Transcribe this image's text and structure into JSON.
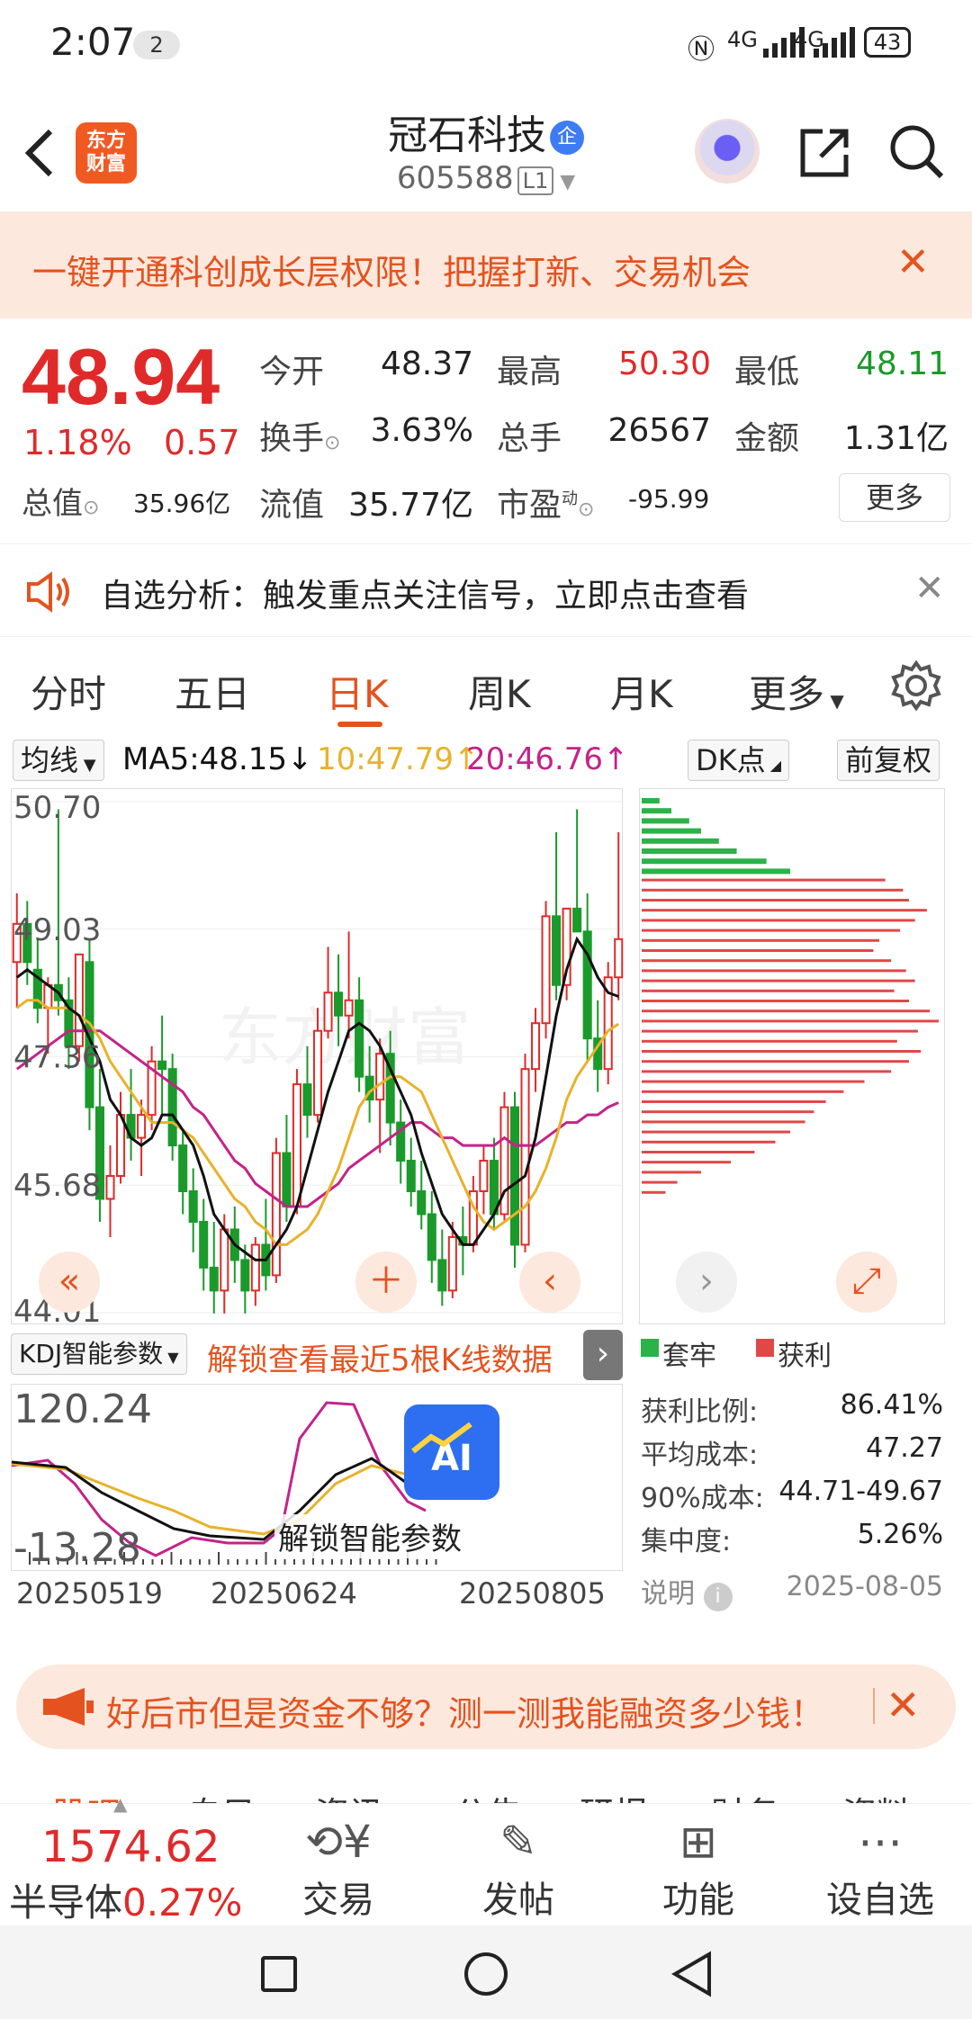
{
  "status": {
    "time": "2:07",
    "notif_count": "2",
    "signal1": "4G",
    "signal2": "4G",
    "battery": "43"
  },
  "header": {
    "logo_line1": "东方",
    "logo_line2": "财富",
    "title": "冠石科技",
    "badge": "企",
    "code": "605588",
    "level": "L1"
  },
  "promo": {
    "text": "一键开通科创成长层权限！把握打新、交易机会"
  },
  "quote": {
    "price": "48.94",
    "pct": "1.18%",
    "change": "0.57",
    "open_label": "今开",
    "open": "48.37",
    "high_label": "最高",
    "high": "50.30",
    "low_label": "最低",
    "low": "48.11",
    "turnover_label": "换手",
    "turnover": "3.63%",
    "volume_label": "总手",
    "volume": "26567",
    "amount_label": "金额",
    "amount": "1.31亿",
    "mktcap_label": "总值",
    "mktcap": "35.96亿",
    "float_label": "流值",
    "float": "35.77亿",
    "pe_label": "市盈",
    "pe_sup": "动",
    "pe": "-95.99",
    "more": "更多"
  },
  "notice": {
    "text": "自选分析：触发重点关注信号，立即点击查看"
  },
  "tabs": [
    "分时",
    "五日",
    "日K",
    "周K",
    "月K",
    "更多"
  ],
  "ma": {
    "selector": "均线",
    "ma5": "MA5:48.15↓",
    "ma10": "10:47.79↑",
    "ma20": "20:46.76↑",
    "dk": "DK点",
    "adjust": "前复权"
  },
  "chart_data": {
    "type": "candlestick",
    "y_ticks": [
      "50.70",
      "49.03",
      "47.36",
      "45.68",
      "44.01"
    ],
    "ylim": [
      44.01,
      50.7
    ],
    "x_ticks": [
      "20250519",
      "20250624",
      "20250805"
    ],
    "ohlc": [
      [
        48.6,
        49.5,
        48.0,
        49.1
      ],
      [
        49.1,
        49.4,
        48.3,
        48.6
      ],
      [
        48.5,
        48.9,
        47.8,
        48.0
      ],
      [
        48.0,
        48.4,
        47.4,
        48.3
      ],
      [
        48.3,
        50.6,
        47.9,
        48.1
      ],
      [
        48.1,
        48.4,
        47.2,
        47.5
      ],
      [
        47.5,
        48.7,
        47.3,
        48.7
      ],
      [
        48.6,
        48.9,
        46.4,
        46.7
      ],
      [
        46.7,
        47.2,
        45.2,
        45.5
      ],
      [
        45.5,
        46.2,
        45.0,
        45.8
      ],
      [
        45.8,
        46.9,
        45.7,
        46.6
      ],
      [
        46.6,
        47.2,
        46.0,
        46.3
      ],
      [
        46.3,
        46.8,
        45.8,
        46.6
      ],
      [
        46.6,
        47.5,
        46.4,
        47.3
      ],
      [
        47.3,
        47.9,
        46.6,
        47.2
      ],
      [
        47.2,
        47.4,
        46.0,
        46.2
      ],
      [
        46.2,
        46.4,
        45.3,
        45.6
      ],
      [
        45.6,
        45.9,
        44.8,
        45.2
      ],
      [
        45.2,
        45.5,
        44.3,
        44.6
      ],
      [
        44.6,
        45.2,
        44.0,
        44.3
      ],
      [
        44.3,
        45.3,
        44.0,
        45.1
      ],
      [
        45.1,
        45.4,
        44.4,
        44.7
      ],
      [
        44.7,
        44.9,
        44.0,
        44.3
      ],
      [
        44.3,
        45.0,
        44.1,
        44.9
      ],
      [
        44.9,
        45.5,
        44.3,
        44.5
      ],
      [
        44.5,
        46.3,
        44.4,
        46.1
      ],
      [
        46.1,
        46.6,
        45.2,
        45.4
      ],
      [
        45.4,
        47.2,
        45.3,
        47.0
      ],
      [
        47.0,
        47.5,
        46.3,
        46.6
      ],
      [
        46.6,
        48.0,
        46.5,
        47.7
      ],
      [
        47.7,
        48.8,
        47.6,
        48.2
      ],
      [
        48.2,
        48.7,
        47.5,
        47.9
      ],
      [
        47.9,
        49.0,
        47.6,
        48.1
      ],
      [
        48.1,
        48.4,
        46.9,
        47.1
      ],
      [
        47.1,
        47.5,
        46.5,
        46.8
      ],
      [
        46.8,
        47.6,
        46.1,
        47.4
      ],
      [
        47.4,
        47.7,
        46.2,
        46.5
      ],
      [
        46.5,
        46.8,
        45.7,
        46.0
      ],
      [
        46.0,
        46.3,
        45.4,
        45.6
      ],
      [
        45.6,
        46.0,
        45.1,
        45.3
      ],
      [
        45.3,
        45.6,
        44.4,
        44.7
      ],
      [
        44.7,
        45.1,
        44.1,
        44.3
      ],
      [
        44.3,
        45.2,
        44.2,
        45.0
      ],
      [
        45.0,
        45.4,
        44.5,
        44.9
      ],
      [
        44.9,
        45.8,
        44.8,
        45.6
      ],
      [
        45.6,
        46.2,
        45.3,
        46.0
      ],
      [
        46.0,
        46.3,
        45.1,
        45.3
      ],
      [
        45.3,
        46.9,
        45.2,
        46.7
      ],
      [
        46.7,
        46.9,
        44.6,
        44.9
      ],
      [
        44.9,
        47.4,
        44.8,
        47.2
      ],
      [
        47.2,
        48.0,
        46.9,
        47.8
      ],
      [
        47.8,
        49.4,
        47.6,
        49.2
      ],
      [
        49.2,
        50.3,
        48.1,
        48.3
      ],
      [
        48.3,
        49.3,
        48.1,
        49.3
      ],
      [
        49.3,
        50.6,
        49.0,
        49.0
      ],
      [
        49.0,
        49.5,
        47.3,
        47.6
      ],
      [
        47.6,
        48.1,
        46.9,
        47.2
      ],
      [
        47.2,
        48.6,
        47.0,
        48.4
      ],
      [
        48.4,
        50.3,
        48.1,
        48.9
      ]
    ],
    "ma5": [
      48.4,
      48.5,
      48.4,
      48.3,
      48.2,
      48.0,
      47.9,
      47.6,
      47.3,
      46.8,
      46.6,
      46.3,
      46.2,
      46.3,
      46.6,
      46.6,
      46.4,
      46.2,
      45.8,
      45.3,
      45.1,
      44.9,
      44.8,
      44.7,
      44.7,
      44.9,
      45.1,
      45.4,
      45.9,
      46.4,
      46.9,
      47.3,
      47.7,
      47.8,
      47.7,
      47.5,
      47.2,
      46.9,
      46.6,
      46.1,
      45.7,
      45.3,
      45.1,
      44.9,
      44.9,
      45.1,
      45.3,
      45.6,
      45.7,
      45.8,
      46.3,
      47.1,
      47.9,
      48.5,
      48.9,
      48.7,
      48.4,
      48.2,
      48.15
    ],
    "ma10": [
      48.0,
      48.1,
      48.1,
      48.0,
      48.0,
      48.0,
      47.9,
      47.8,
      47.6,
      47.3,
      47.1,
      46.9,
      46.7,
      46.5,
      46.5,
      46.5,
      46.4,
      46.3,
      46.1,
      45.9,
      45.7,
      45.5,
      45.4,
      45.2,
      45.1,
      44.9,
      44.9,
      45.0,
      45.1,
      45.3,
      45.6,
      45.9,
      46.3,
      46.7,
      46.9,
      47.0,
      47.1,
      47.1,
      47.0,
      46.9,
      46.6,
      46.3,
      46.0,
      45.7,
      45.4,
      45.2,
      45.1,
      45.2,
      45.3,
      45.4,
      45.6,
      45.9,
      46.3,
      46.8,
      47.1,
      47.3,
      47.5,
      47.7,
      47.79
    ],
    "ma20": [
      47.2,
      47.3,
      47.4,
      47.5,
      47.6,
      47.7,
      47.7,
      47.7,
      47.7,
      47.6,
      47.5,
      47.4,
      47.3,
      47.2,
      47.1,
      47.0,
      46.9,
      46.7,
      46.6,
      46.4,
      46.2,
      46.0,
      45.9,
      45.7,
      45.6,
      45.5,
      45.4,
      45.4,
      45.4,
      45.5,
      45.6,
      45.7,
      45.9,
      46.0,
      46.1,
      46.2,
      46.3,
      46.4,
      46.5,
      46.5,
      46.4,
      46.3,
      46.3,
      46.2,
      46.2,
      46.2,
      46.2,
      46.3,
      46.2,
      46.2,
      46.2,
      46.3,
      46.4,
      46.5,
      46.5,
      46.6,
      46.6,
      46.7,
      46.76
    ]
  },
  "chip_dist": {
    "legend": [
      "套牢",
      "获利"
    ],
    "green_widths": [
      0.06,
      0.1,
      0.16,
      0.2,
      0.26,
      0.32,
      0.42,
      0.5
    ],
    "red_widths": [
      0.82,
      0.88,
      0.9,
      0.96,
      0.92,
      0.87,
      0.8,
      0.78,
      0.84,
      0.89,
      0.92,
      0.85,
      0.9,
      0.97,
      1.0,
      0.93,
      0.86,
      0.94,
      0.9,
      0.84,
      0.75,
      0.68,
      0.62,
      0.58,
      0.55,
      0.5,
      0.45,
      0.38,
      0.3,
      0.2,
      0.12,
      0.08
    ]
  },
  "kdj": {
    "selector": "KDJ智能参数",
    "unlock": "解锁查看最近5根K线数据",
    "top": "120.24",
    "bottom": "-13.28",
    "ai_label": "AI",
    "unlock_ai": "解锁智能参数"
  },
  "stats": {
    "ratio_label": "获利比例:",
    "ratio": "86.41%",
    "avg_label": "平均成本:",
    "avg": "47.27",
    "c90_label": "90%成本:",
    "c90": "44.71-49.67",
    "conc_label": "集中度:",
    "conc": "5.26%",
    "note_label": "说明",
    "date": "2025-08-05"
  },
  "fund_banner": {
    "text": "好后市但是资金不够？测一测我能融资多少钱！"
  },
  "peek_tabs": [
    "股吧",
    "自目",
    "资讯",
    "公告",
    "研报",
    "财务",
    "资料"
  ],
  "bottom": {
    "index_value": "1574.62",
    "index_name": "半导体",
    "index_pct": "0.27%",
    "trade": "交易",
    "post": "发帖",
    "func": "功能",
    "watch": "设自选"
  },
  "colors": {
    "accent": "#e4531f",
    "up": "#e02a2a",
    "down": "#1a9a2a",
    "ma5": "#111111",
    "ma10": "#e8b22a",
    "ma20": "#c4238a"
  }
}
